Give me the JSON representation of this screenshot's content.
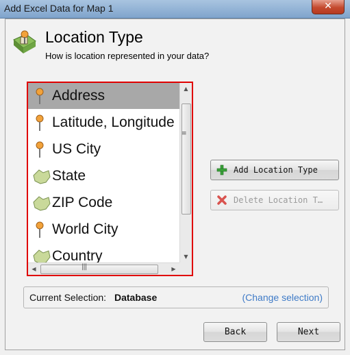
{
  "window": {
    "title": "Add Excel Data for Map 1",
    "close_glyph": "✕"
  },
  "header": {
    "title": "Location Type",
    "subtitle": "How is location represented in your data?",
    "icon": "map-icon"
  },
  "location_list": {
    "items": [
      {
        "label": "Address",
        "icon": "pushpin-icon",
        "selected": true
      },
      {
        "label": "Latitude, Longitude",
        "icon": "pushpin-icon",
        "selected": false
      },
      {
        "label": "US City",
        "icon": "pushpin-icon",
        "selected": false
      },
      {
        "label": "State",
        "icon": "region-icon",
        "selected": false
      },
      {
        "label": "ZIP Code",
        "icon": "region-icon",
        "selected": false
      },
      {
        "label": "World City",
        "icon": "pushpin-icon",
        "selected": false
      },
      {
        "label": "Country",
        "icon": "region-icon",
        "selected": false
      }
    ],
    "highlight_color": "#e00000"
  },
  "actions": {
    "add_label": "Add Location Type",
    "delete_label": "Delete Location T…"
  },
  "selection": {
    "label": "Current Selection:",
    "value": "Database",
    "link": "(Change selection)"
  },
  "nav": {
    "back_label": "Back",
    "next_label": "Next"
  },
  "colors": {
    "link": "#3f7bc7",
    "selected_row": "#a8a8a8",
    "add_icon": "#3aa33a",
    "delete_icon": "#d9534f"
  }
}
